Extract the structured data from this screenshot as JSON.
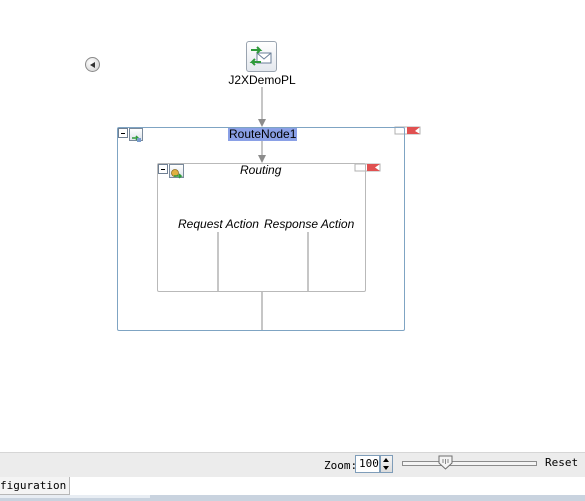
{
  "canvas": {
    "pipeline": {
      "label": "J2XDemoPL",
      "icon": "pipeline-envelope-arrows-icon"
    },
    "route_node": {
      "label": "RouteNode1",
      "icon": "route-node-icon",
      "flag_icon": "error-flag-icon"
    },
    "routing": {
      "label": "Routing",
      "icon": "routing-icon",
      "flag_icon": "error-flag-icon"
    },
    "request_action": {
      "label": "Request Action"
    },
    "response_action": {
      "label": "Response Action"
    },
    "back_icon": "back-arrow-icon"
  },
  "zoom": {
    "label": "Zoom:",
    "value": "100",
    "reset_label": "Reset",
    "slider_level_percent": 32
  },
  "tabs": [
    {
      "label": "figuration"
    }
  ],
  "colors": {
    "route_box_border": "#7fa4c3",
    "selection_highlight": "#8aa0e6",
    "flag": "#e05050"
  }
}
